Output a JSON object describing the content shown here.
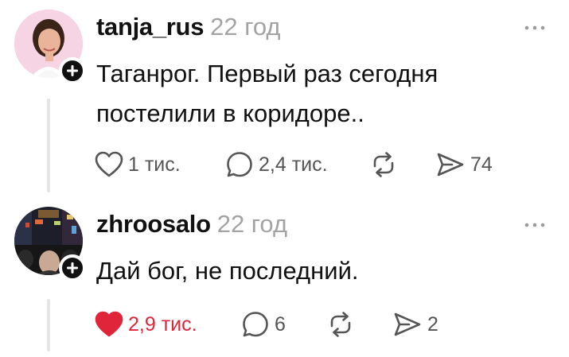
{
  "colors": {
    "liked": "#e0243a",
    "text": "#111111",
    "muted": "#a3a3a3",
    "icon": "#555555",
    "thread_line": "#e5e5e5"
  },
  "posts": [
    {
      "username": "tanja_rus",
      "time": "22 год",
      "text": "Таганрог. Первый раз сегодня постелили в коридоре..",
      "likes": "1 тис.",
      "replies": "2,4 тис.",
      "reposts": "",
      "shares": "74",
      "liked": false
    },
    {
      "username": "zhroosalo",
      "time": "22 год",
      "text": "Дай бог, не последний.",
      "likes": "2,9 тис.",
      "replies": "6",
      "reposts": "",
      "shares": "2",
      "liked": true
    }
  ],
  "icons": {
    "follow": "plus-icon",
    "more": "more-dots-icon",
    "like": "heart-icon",
    "reply": "comment-bubble-icon",
    "repost": "repost-icon",
    "share": "share-send-icon"
  }
}
